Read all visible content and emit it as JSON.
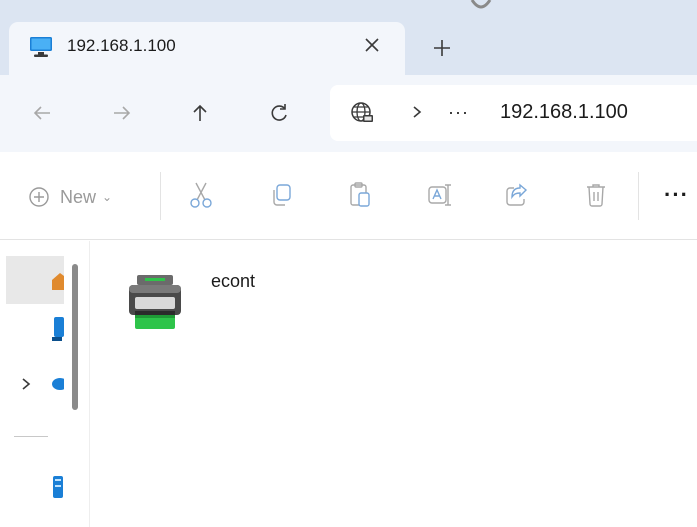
{
  "tab": {
    "title": "192.168.1.100",
    "icon": "monitor-icon",
    "close_icon": "close-icon",
    "new_tab_icon": "plus-icon"
  },
  "navigation": {
    "back_icon": "arrow-left-icon",
    "forward_icon": "arrow-right-icon",
    "up_icon": "arrow-up-icon",
    "refresh_icon": "refresh-icon"
  },
  "address_bar": {
    "location_icon": "network-globe-icon",
    "separator_icon": "chevron-right-icon",
    "overflow": "···",
    "path": "192.168.1.100"
  },
  "command_bar": {
    "new_label": "New",
    "new_caret": "⌄",
    "more": "···",
    "buttons": [
      "cut-icon",
      "copy-icon",
      "paste-icon",
      "rename-icon",
      "share-icon",
      "delete-icon"
    ]
  },
  "content": {
    "items": [
      {
        "label": "econt",
        "icon": "printer-icon"
      }
    ]
  },
  "colors": {
    "tab_strip": "#dce5f2",
    "nav_background": "#f3f6fb",
    "accent_blue": "#0067c0",
    "printer_green": "#2ec44a"
  }
}
